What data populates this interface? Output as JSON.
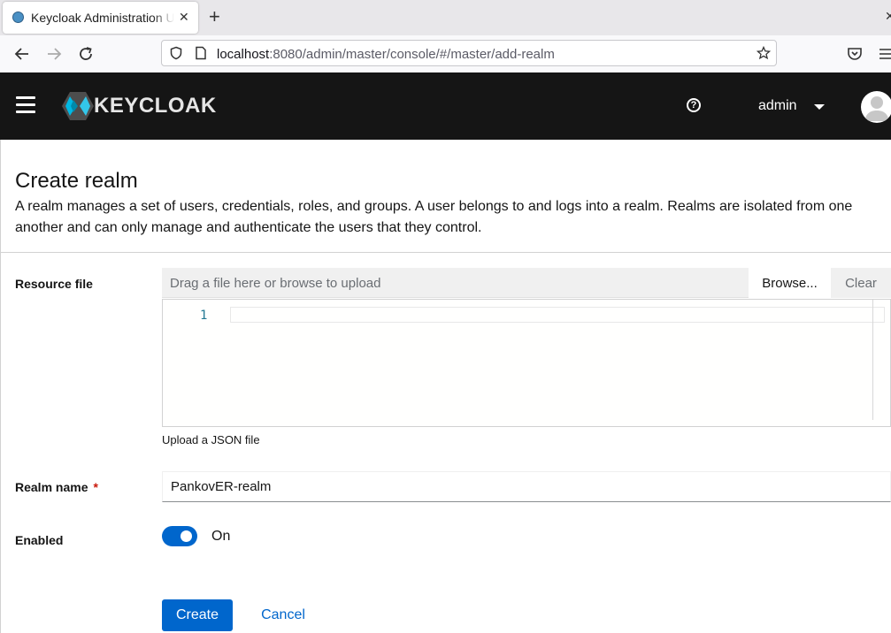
{
  "browser": {
    "tab_title": "Keycloak Administration UI",
    "close_glyph": "✕",
    "newtab_glyph": "+",
    "window_close_glyph": "✕",
    "url_host": "localhost",
    "url_rest": ":8080/admin/master/console/#/master/add-realm"
  },
  "header": {
    "logo_text": "KEYCLOAK",
    "help_glyph": "?",
    "user": "admin"
  },
  "page": {
    "title": "Create realm",
    "description": "A realm manages a set of users, credentials, roles, and groups. A user belongs to and logs into a realm. Realms are isolated from one another and can only manage and authenticate the users that they control."
  },
  "form": {
    "resource_file_label": "Resource file",
    "file_placeholder": "Drag a file here or browse to upload",
    "browse_label": "Browse...",
    "clear_label": "Clear",
    "editor_line_number": "1",
    "helper_text": "Upload a JSON file",
    "realm_name_label": "Realm name",
    "required_marker": "*",
    "realm_name_value": "PankovER-realm",
    "enabled_label": "Enabled",
    "enabled_state": "On",
    "create_label": "Create",
    "cancel_label": "Cancel"
  },
  "colors": {
    "primary": "#0066cc",
    "header_bg": "#151515",
    "required": "#c9190b"
  }
}
